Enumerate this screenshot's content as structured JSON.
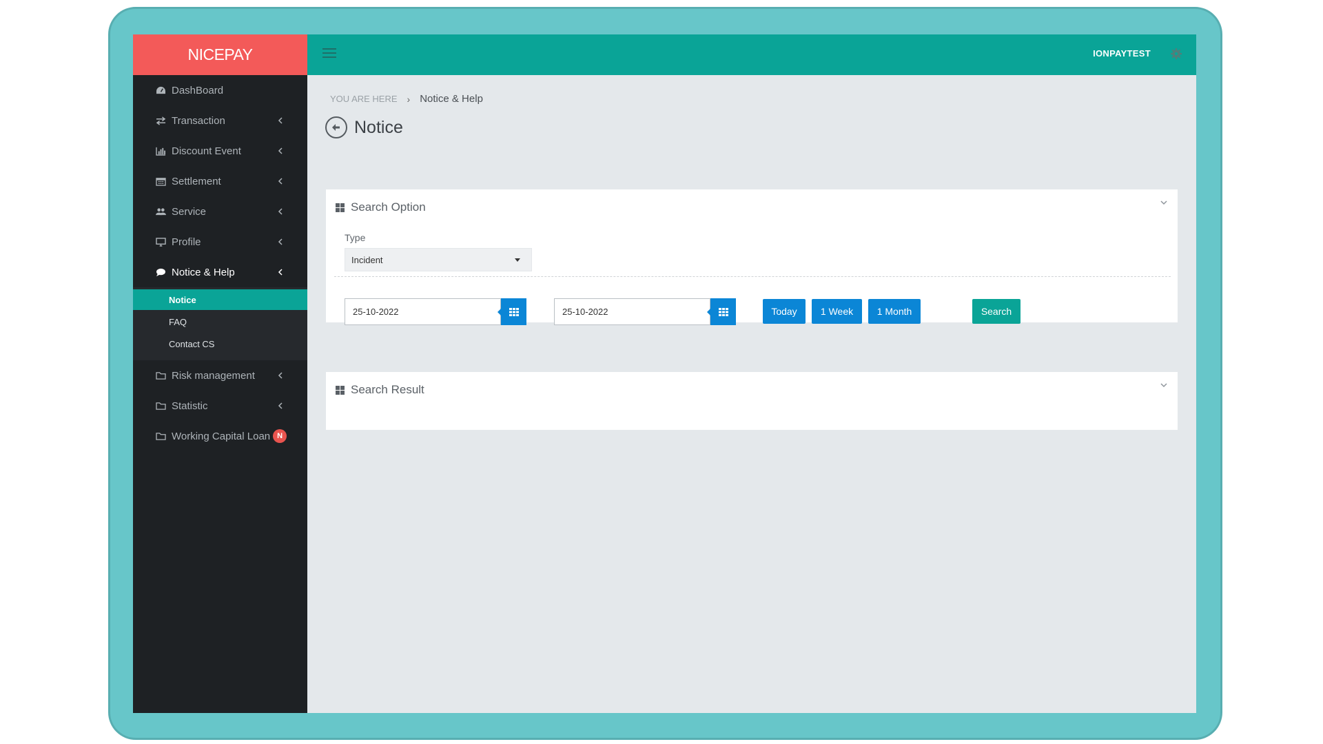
{
  "app": {
    "brand": "NICEPAY"
  },
  "topbar": {
    "user": "IONPAYTEST"
  },
  "sidebar": {
    "items": [
      {
        "label": "DashBoard",
        "icon": "dashboard-icon",
        "chevron": false
      },
      {
        "label": "Transaction",
        "icon": "exchange-icon",
        "chevron": true
      },
      {
        "label": "Discount Event",
        "icon": "bar-chart-icon",
        "chevron": true
      },
      {
        "label": "Settlement",
        "icon": "calendar-icon",
        "chevron": true
      },
      {
        "label": "Service",
        "icon": "users-icon",
        "chevron": true
      },
      {
        "label": "Profile",
        "icon": "desktop-icon",
        "chevron": true
      },
      {
        "label": "Notice & Help",
        "icon": "comment-icon",
        "chevron": true,
        "active": true
      },
      {
        "label": "Risk management",
        "icon": "folder-icon",
        "chevron": true
      },
      {
        "label": "Statistic",
        "icon": "folder-icon",
        "chevron": true
      },
      {
        "label": "Working Capital Loan",
        "icon": "folder-icon",
        "chevron": false,
        "badge": "N"
      }
    ],
    "sub_items": [
      {
        "label": "Notice",
        "active": true
      },
      {
        "label": "FAQ"
      },
      {
        "label": "Contact CS"
      }
    ]
  },
  "breadcrumb": {
    "label": "YOU ARE HERE",
    "separator": "›",
    "current": "Notice & Help"
  },
  "page": {
    "title": "Notice"
  },
  "search_option": {
    "title": "Search Option",
    "type_label": "Type",
    "type_value": "Incident",
    "date_from": "25-10-2022",
    "date_to": "25-10-2022",
    "buttons": {
      "today": "Today",
      "week": "1 Week",
      "month": "1 Month",
      "search": "Search"
    }
  },
  "search_result": {
    "title": "Search Result"
  },
  "colors": {
    "brand": "#f35a59",
    "teal": "#0aa497",
    "blue": "#0b86d6",
    "sidebar": "#1e2124"
  }
}
